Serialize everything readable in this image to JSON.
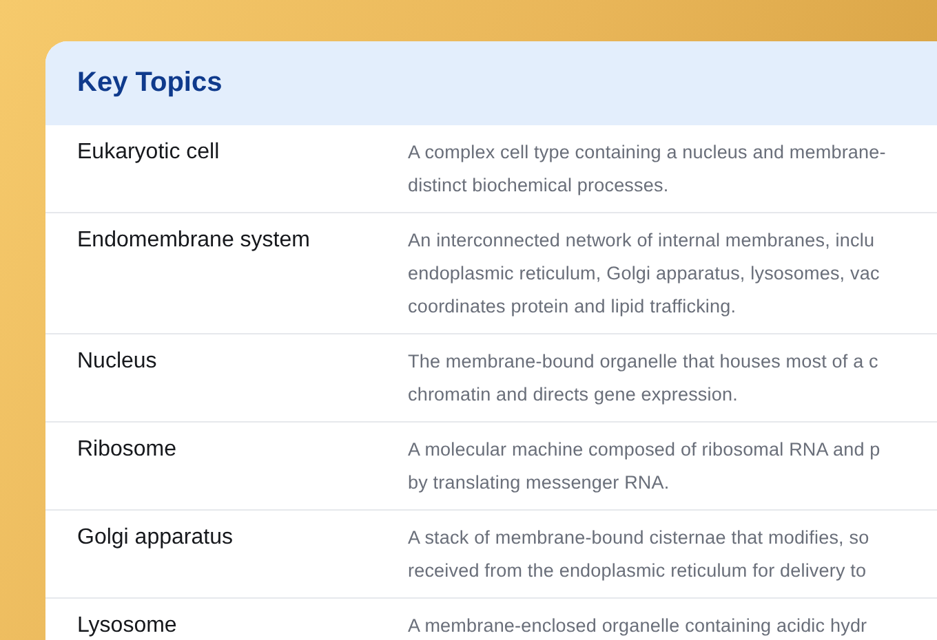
{
  "panel": {
    "title": "Key Topics"
  },
  "topics": [
    {
      "term": "Eukaryotic cell",
      "description_lines": [
        "A complex cell type containing a nucleus and membrane-",
        "distinct biochemical processes."
      ]
    },
    {
      "term": "Endomembrane system",
      "description_lines": [
        "An interconnected network of internal membranes, inclu",
        "endoplasmic reticulum, Golgi apparatus, lysosomes, vac",
        "coordinates protein and lipid trafficking."
      ]
    },
    {
      "term": "Nucleus",
      "description_lines": [
        "The membrane-bound organelle that houses most of a c",
        "chromatin and directs gene expression."
      ]
    },
    {
      "term": "Ribosome",
      "description_lines": [
        "A molecular machine composed of ribosomal RNA and p",
        "by translating messenger RNA."
      ]
    },
    {
      "term": "Golgi apparatus",
      "description_lines": [
        "A stack of membrane-bound cisternae that modifies, so",
        "received from the endoplasmic reticulum for delivery to"
      ]
    },
    {
      "term": "Lysosome",
      "description_lines": [
        "A membrane-enclosed organelle containing acidic hydr"
      ]
    }
  ]
}
